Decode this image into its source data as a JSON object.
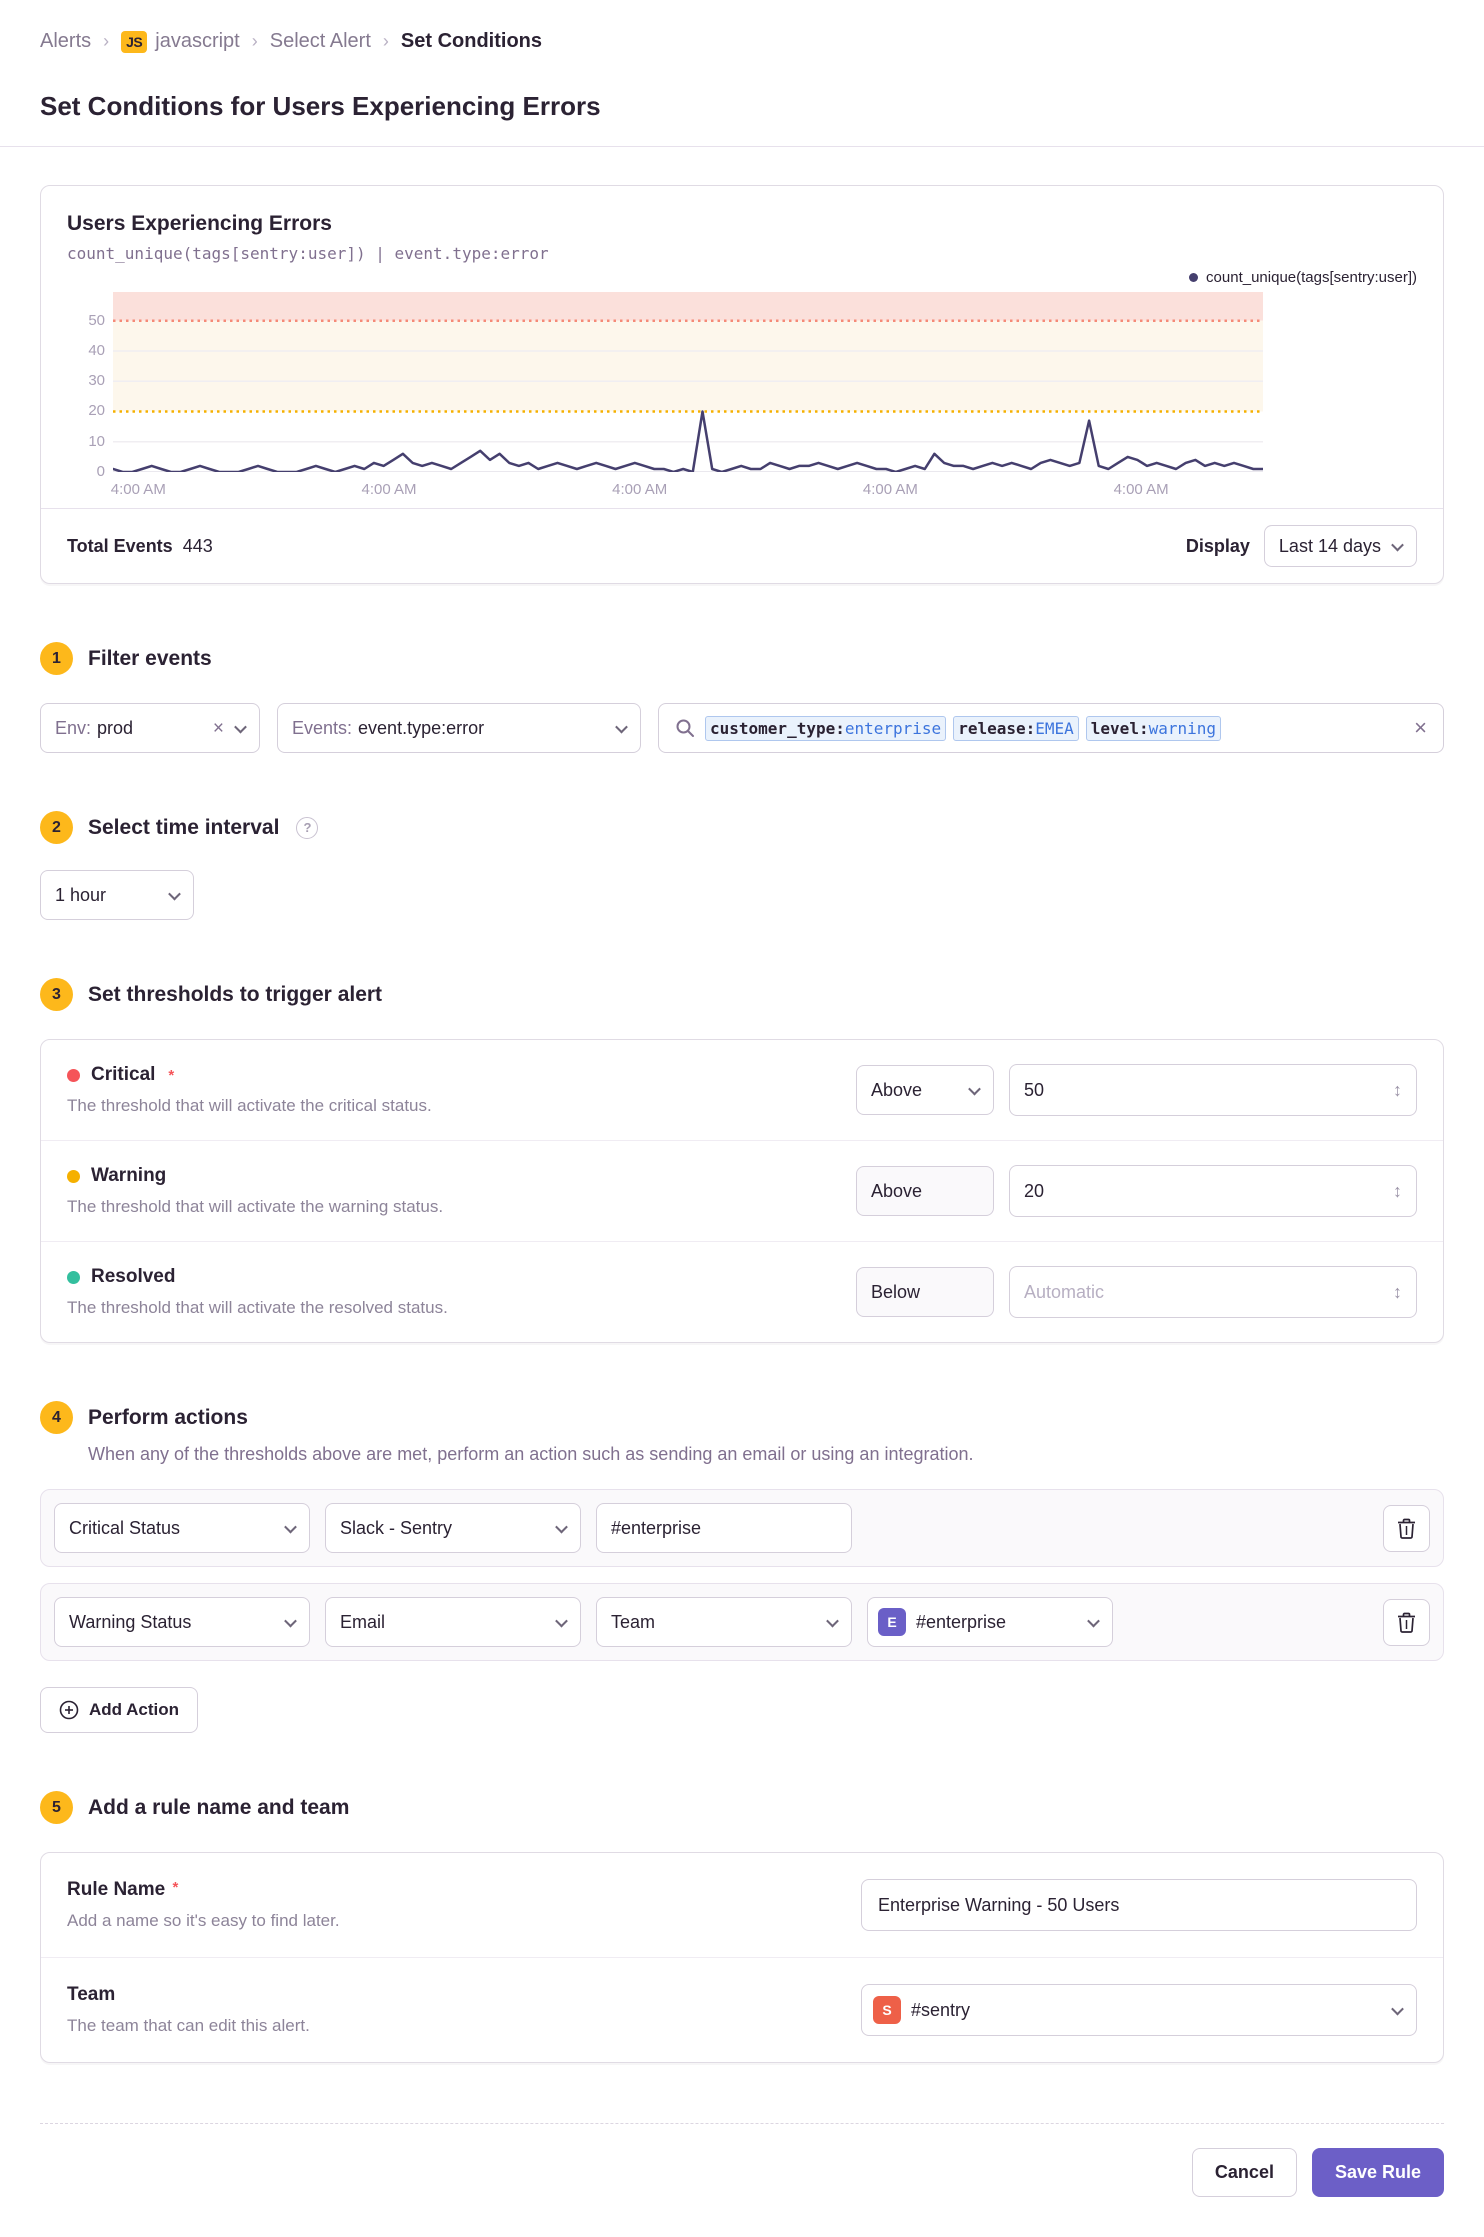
{
  "breadcrumb": {
    "alerts": "Alerts",
    "project_badge": "JS",
    "project": "javascript",
    "select_alert": "Select Alert",
    "current": "Set Conditions"
  },
  "page": {
    "title": "Set Conditions for Users Experiencing Errors"
  },
  "chart": {
    "title": "Users Experiencing Errors",
    "query": "count_unique(tags[sentry:user]) | event.type:error",
    "legend": "count_unique(tags[sentry:user])",
    "total_events_label": "Total Events",
    "total_events_value": "443",
    "display_label": "Display",
    "display_value": "Last 14 days"
  },
  "chart_data": {
    "type": "line",
    "title": "Users Experiencing Errors",
    "series_name": "count_unique(tags[sentry:user])",
    "ylim": [
      0,
      59.5
    ],
    "yticks": [
      0,
      10,
      20,
      30,
      40,
      50
    ],
    "grid_yticks": [
      10,
      30,
      40
    ],
    "x_categories": [
      "4:00 AM",
      "4:00 AM",
      "4:00 AM",
      "4:00 AM",
      "4:00 AM"
    ],
    "x_label_fractions": [
      0.022,
      0.24,
      0.458,
      0.676,
      0.894
    ],
    "thresholds": {
      "critical": 50,
      "warning": 20
    },
    "colors": {
      "series": "#453F6E",
      "critical_line": "#F58A77",
      "warning_line": "#F5B000",
      "critical_band": "#FBE0DB",
      "warning_band": "#FDF7EC",
      "grid": "#F0EEF2",
      "baseline": "#E4E0E8"
    },
    "values": [
      1,
      0,
      0,
      1,
      2,
      1,
      0,
      0,
      1,
      2,
      1,
      0,
      0,
      0,
      1,
      2,
      1,
      0,
      0,
      0,
      1,
      2,
      1,
      0,
      1,
      2,
      1,
      3,
      2,
      4,
      6,
      3,
      2,
      3,
      2,
      1,
      3,
      5,
      7,
      4,
      6,
      3,
      2,
      3,
      1,
      2,
      3,
      2,
      1,
      2,
      3,
      2,
      1,
      2,
      3,
      2,
      1,
      1,
      0,
      1,
      0,
      20,
      1,
      0,
      1,
      2,
      1,
      1,
      3,
      2,
      1,
      2,
      2,
      3,
      2,
      1,
      2,
      3,
      2,
      1,
      1,
      0,
      1,
      2,
      1,
      6,
      3,
      2,
      2,
      1,
      2,
      3,
      2,
      3,
      2,
      1,
      3,
      4,
      3,
      2,
      3,
      17,
      2,
      1,
      3,
      5,
      4,
      2,
      3,
      2,
      1,
      3,
      4,
      2,
      3,
      2,
      3,
      2,
      1,
      1
    ]
  },
  "sections": {
    "filter": {
      "num": "1",
      "title": "Filter events",
      "env_label": "Env:",
      "env_value": "prod",
      "events_label": "Events:",
      "events_value": "event.type:error",
      "tokens": [
        {
          "key": "customer_type:",
          "value": "enterprise"
        },
        {
          "key": "release:",
          "value": "EMEA"
        },
        {
          "key": "level:",
          "value": "warning"
        }
      ]
    },
    "interval": {
      "num": "2",
      "title": "Select time interval",
      "help": "?",
      "value": "1 hour"
    },
    "thresholds": {
      "num": "3",
      "title": "Set thresholds to trigger alert",
      "rows": [
        {
          "name": "Critical",
          "required": "*",
          "dot_color": "#F55459",
          "desc": "The threshold that will activate the critical status.",
          "op": "Above",
          "value": "50"
        },
        {
          "name": "Warning",
          "dot_color": "#F5B000",
          "desc": "The threshold that will activate the warning status.",
          "op": "Above",
          "value": "20"
        },
        {
          "name": "Resolved",
          "dot_color": "#33BF9E",
          "desc": "The threshold that will activate the resolved status.",
          "op": "Below",
          "placeholder": "Automatic"
        }
      ]
    },
    "actions": {
      "num": "4",
      "title": "Perform actions",
      "desc": "When any of the thresholds above are met, perform an action such as sending an email or using an integration.",
      "rows": [
        {
          "status": "Critical Status",
          "service": "Slack - Sentry",
          "target_input": "#enterprise"
        },
        {
          "status": "Warning Status",
          "service": "Email",
          "target_type": "Team",
          "team": {
            "avatar": "E",
            "avatar_color": "#6A5FC7",
            "label": "#enterprise"
          }
        }
      ],
      "add_label": "Add Action"
    },
    "naming": {
      "num": "5",
      "title": "Add a rule name and team",
      "rule_label": "Rule Name",
      "rule_required": "*",
      "rule_desc": "Add a name so it's easy to find later.",
      "rule_value": "Enterprise Warning - 50 Users",
      "team_label": "Team",
      "team_desc": "The team that can edit this alert.",
      "team": {
        "avatar": "S",
        "avatar_color": "#EE6048",
        "label": "#sentry"
      }
    }
  },
  "footer": {
    "cancel": "Cancel",
    "save": "Save Rule"
  }
}
